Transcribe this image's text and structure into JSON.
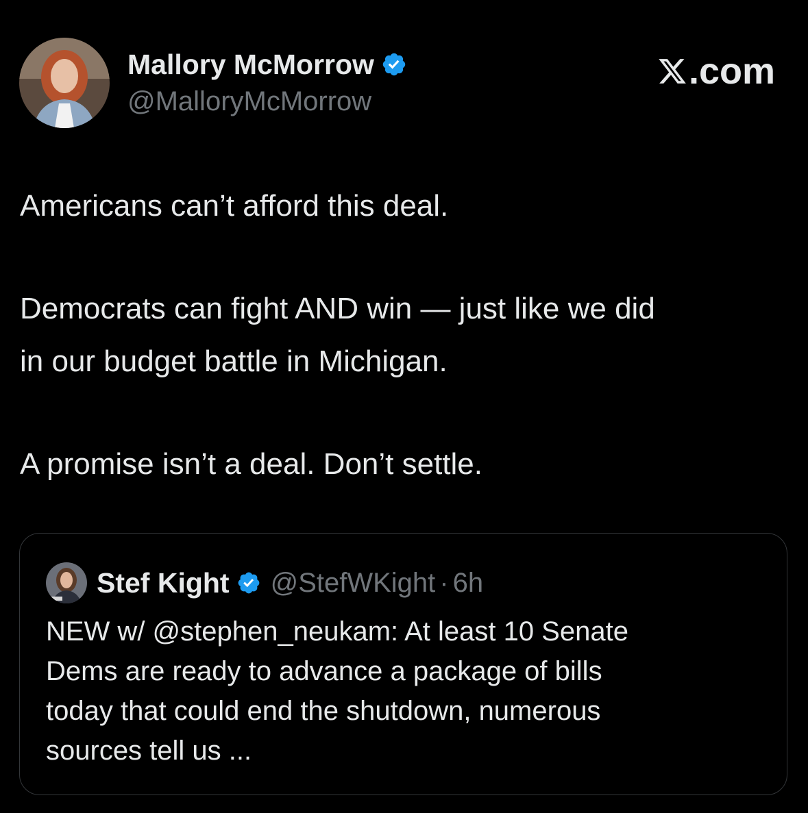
{
  "author": {
    "name": "Mallory McMorrow",
    "handle": "@MalloryMcMorrow",
    "avatar_icon": "profile-photo",
    "verified_icon": "verified-badge-icon"
  },
  "brand": {
    "logo_text": ".com",
    "logo_icon": "x-logo-icon"
  },
  "tweet": {
    "line1": "Americans can’t afford this deal.",
    "line2": "Democrats can fight AND win — just like we did",
    "line3": "in our budget battle in Michigan.",
    "line4": "A promise isn’t a deal. Don’t settle."
  },
  "quote": {
    "name": "Stef Kight",
    "handle": "@StefWKight",
    "separator": "·",
    "time": "6h",
    "line1": "NEW w/ @stephen_neukam: At least 10 Senate",
    "line2": "Dems are ready to advance a package of bills",
    "line3": "today that could end the shutdown, numerous",
    "line4": "sources tell us ..."
  },
  "colors": {
    "background": "#000000",
    "text": "#e7e9ea",
    "secondary": "#71767b",
    "verified": "#1d9bf0",
    "border": "#333639"
  }
}
